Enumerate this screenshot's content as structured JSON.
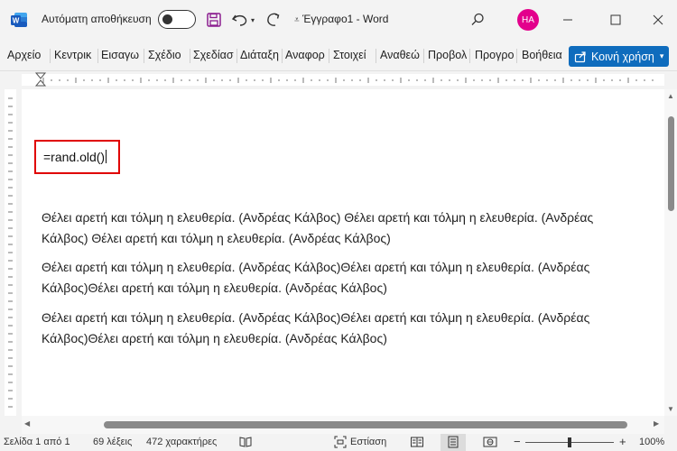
{
  "titlebar": {
    "autosave_label": "Αυτόματη αποθήκευση",
    "autosave_on": false,
    "doc_title": "Έγγραφο1  -  Word",
    "avatar_initials": "HA"
  },
  "ribbon": {
    "tabs": [
      "Αρχείο",
      "Κεντρικ",
      "Εισαγω",
      "Σχέδιο",
      "Σχεδίασ",
      "Διάταξη",
      "Αναφορ",
      "Στοιχεί",
      "Αναθεώ",
      "Προβολ",
      "Προγρο",
      "Βοήθεια"
    ],
    "share_label": "Κοινή χρήση"
  },
  "document": {
    "input_text": "=rand.old()",
    "paragraphs": [
      "Θέλει αρετή και τόλμη η ελευθερία. (Ανδρέας Κάλβος) Θέλει αρετή και τόλμη η ελευθερία. (Ανδρέας Κάλβος) Θέλει αρετή και τόλμη η ελευθερία. (Ανδρέας Κάλβος)",
      "Θέλει αρετή και τόλμη η ελευθερία. (Ανδρέας Κάλβος)Θέλει αρετή και τόλμη η ελευθερία. (Ανδρέας Κάλβος)Θέλει αρετή και τόλμη η ελευθερία. (Ανδρέας Κάλβος)",
      "Θέλει αρετή και τόλμη η ελευθερία. (Ανδρέας Κάλβος)Θέλει αρετή και τόλμη η ελευθερία. (Ανδρέας Κάλβος)Θέλει αρετή και τόλμη η ελευθερία. (Ανδρέας Κάλβος)"
    ]
  },
  "statusbar": {
    "page": "Σελίδα 1 από 1",
    "words": "69 λέξεις",
    "chars": "472 χαρακτήρες",
    "focus": "Εστίαση",
    "zoom": "100%"
  },
  "colors": {
    "accent": "#0f6cbd",
    "highlight_border": "#e00000",
    "avatar": "#e3008c"
  }
}
